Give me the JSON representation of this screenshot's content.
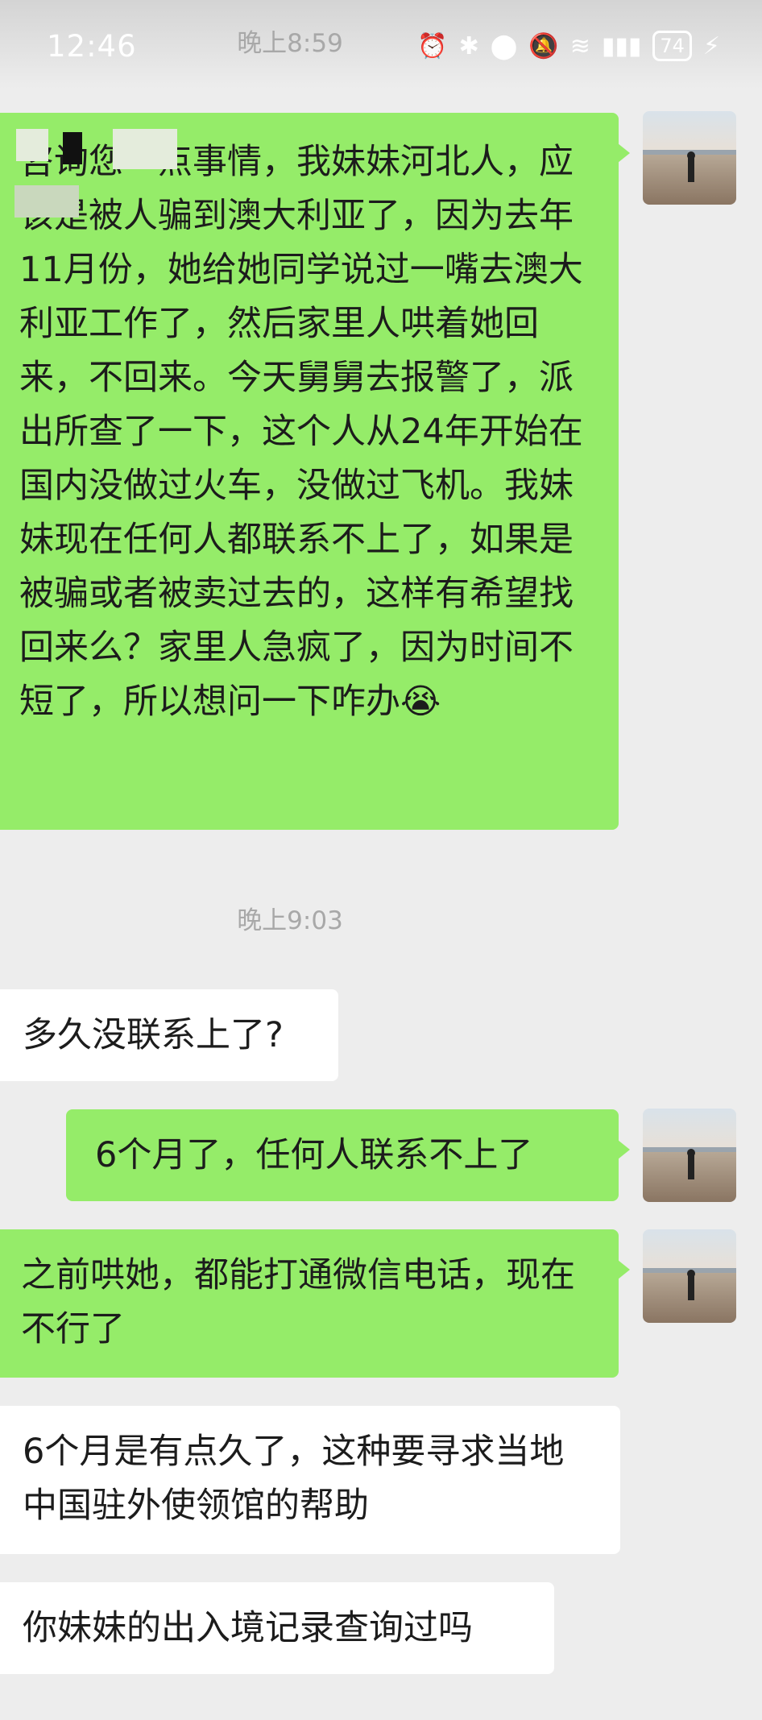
{
  "status_bar": {
    "time": "12:46",
    "battery": "74"
  },
  "timestamps": {
    "first": "晚上8:59",
    "second": "晚上9:03"
  },
  "messages": [
    {
      "side": "me",
      "text": "咨询您一点事情，我妹妹河北人，应该是被人骗到澳大利亚了，因为去年11月份，她给她同学说过一嘴去澳大利亚工作了，然后家里人哄着她回来，不回来。今天舅舅去报警了，派出所查了一下，这个人从24年开始在国内没做过火车，没做过飞机。我妹妹现在任何人都联系不上了，如果是被骗或者被卖过去的，这样有希望找回来么？家里人急疯了，因为时间不短了，所以想问一下咋办😭"
    },
    {
      "side": "them",
      "text": "多久没联系上了?"
    },
    {
      "side": "me",
      "text": "6个月了，任何人联系不上了"
    },
    {
      "side": "me",
      "text": "之前哄她，都能打通微信电话，现在不行了"
    },
    {
      "side": "them",
      "text": "6个月是有点久了，这种要寻求当地中国驻外使领馆的帮助"
    },
    {
      "side": "them",
      "text": "你妹妹的出入境记录查询过吗"
    }
  ],
  "colors": {
    "background": "#ededed",
    "my_bubble": "#95ec69",
    "their_bubble": "#ffffff",
    "timestamp": "#a8a8a8"
  }
}
